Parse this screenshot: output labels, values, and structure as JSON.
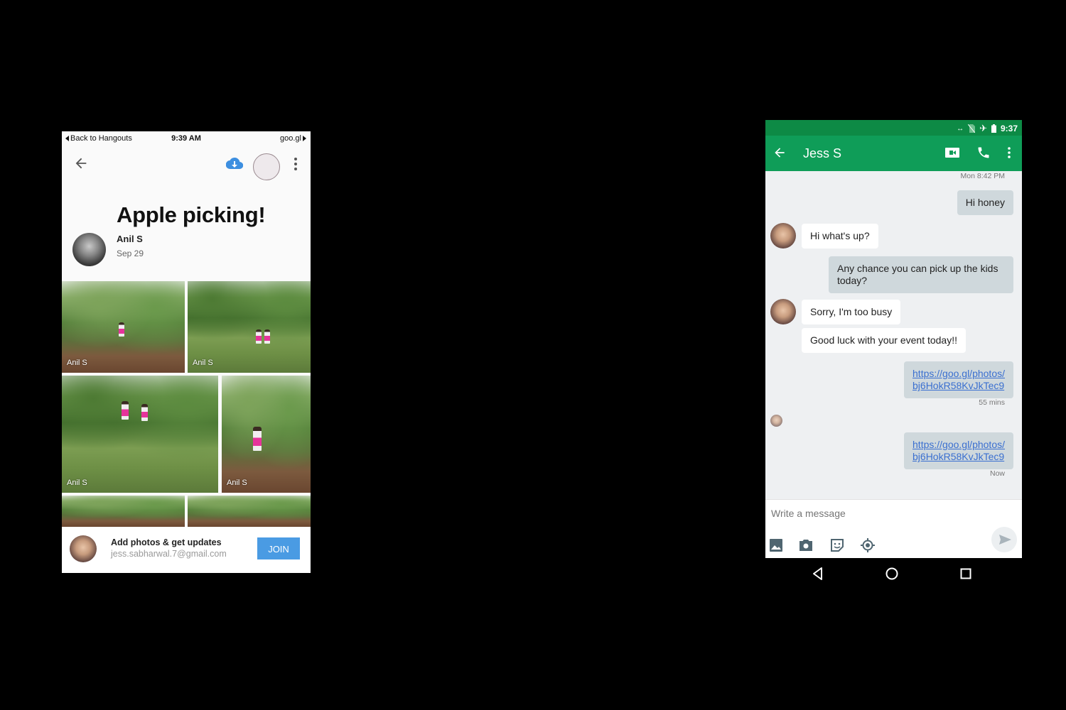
{
  "ios_phone": {
    "status_bar": {
      "back_label": "Back to Hangouts",
      "time": "9:39 AM",
      "site": "goo.gl"
    },
    "toolbar": {
      "back_icon": "arrow-left-icon",
      "download_icon": "cloud-download-icon",
      "profile_icon": "avatar-ring-icon",
      "more_icon": "more-vertical-icon"
    },
    "album": {
      "title": "Apple picking!",
      "owner": "Anil S",
      "date": "Sep 29"
    },
    "photos": [
      {
        "caption": "Anil S"
      },
      {
        "caption": "Anil S"
      },
      {
        "caption": "Anil S"
      },
      {
        "caption": "Anil S"
      },
      {
        "caption": ""
      },
      {
        "caption": ""
      }
    ],
    "join_bar": {
      "title": "Add photos & get updates",
      "email": "jess.sabharwal.7@gmail.com",
      "button": "JOIN",
      "button_color": "#4a9be3"
    }
  },
  "android_phone": {
    "status_bar": {
      "time": "9:37",
      "icons": [
        "data-sync-icon",
        "no-sim-icon",
        "airplane-icon",
        "battery-icon"
      ]
    },
    "app_bar": {
      "title": "Jess S",
      "color": "#0f9d58",
      "actions": [
        "video-call-icon",
        "phone-icon",
        "more-vertical-icon"
      ]
    },
    "conversation": {
      "timestamp_top": "Mon 8:42 PM",
      "messages": [
        {
          "direction": "out",
          "text": "Hi honey"
        },
        {
          "direction": "in",
          "text": "Hi what's up?"
        },
        {
          "direction": "out",
          "text": "Any chance you can pick up the kids today?"
        },
        {
          "direction": "in",
          "text": "Sorry, I'm too busy"
        },
        {
          "direction": "in",
          "text": "Good luck with your event today!!"
        },
        {
          "direction": "out",
          "link_line1": "https://goo.gl/photos/",
          "link_line2": "bj6HokR58KvJkTec9",
          "time": "55 mins"
        },
        {
          "direction": "out",
          "link_line1": "https://goo.gl/photos/",
          "link_line2": "bj6HokR58KvJkTec9",
          "time": "Now"
        }
      ]
    },
    "composer": {
      "placeholder": "Write a message",
      "tools": [
        "image-icon",
        "camera-icon",
        "sticker-icon",
        "location-icon"
      ],
      "send_icon": "send-icon"
    },
    "nav_bar": [
      "back-triangle-icon",
      "home-circle-icon",
      "recents-square-icon"
    ]
  }
}
